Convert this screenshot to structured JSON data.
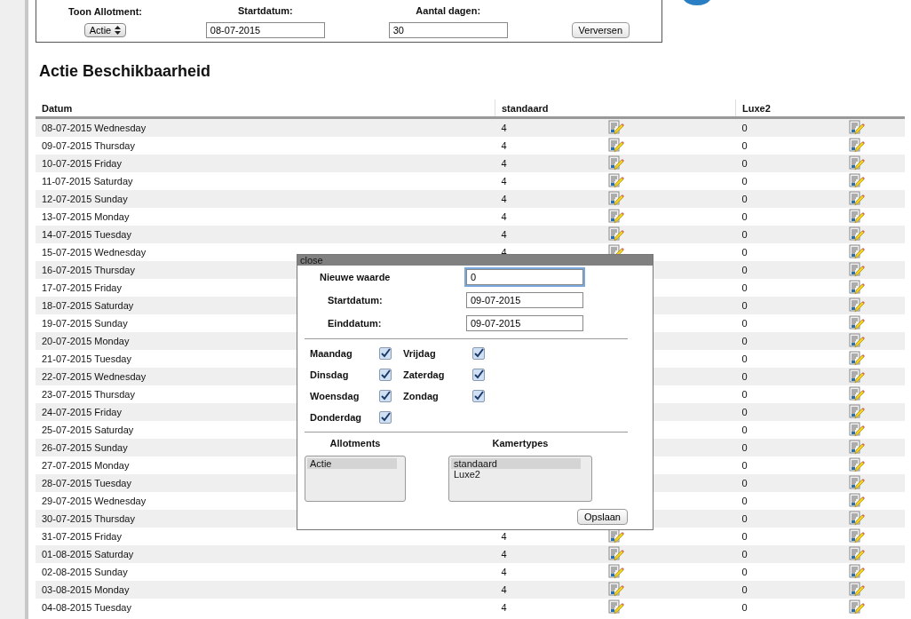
{
  "filter": {
    "allotment_label": "Toon Allotment:",
    "allotment_value": "Actie",
    "start_label": "Startdatum:",
    "start_value": "08-07-2015",
    "days_label": "Aantal dagen:",
    "days_value": "30",
    "refresh_button": "Verversen"
  },
  "heading": "Actie Beschikbaarheid",
  "table": {
    "columns": [
      "Datum",
      "standaard",
      "Luxe2"
    ],
    "rows": [
      {
        "date": "08-07-2015 Wednesday",
        "standaard": "4",
        "luxe2": "0"
      },
      {
        "date": "09-07-2015 Thursday",
        "standaard": "4",
        "luxe2": "0"
      },
      {
        "date": "10-07-2015 Friday",
        "standaard": "4",
        "luxe2": "0"
      },
      {
        "date": "11-07-2015 Saturday",
        "standaard": "4",
        "luxe2": "0"
      },
      {
        "date": "12-07-2015 Sunday",
        "standaard": "4",
        "luxe2": "0"
      },
      {
        "date": "13-07-2015 Monday",
        "standaard": "4",
        "luxe2": "0"
      },
      {
        "date": "14-07-2015 Tuesday",
        "standaard": "4",
        "luxe2": "0"
      },
      {
        "date": "15-07-2015 Wednesday",
        "standaard": "4",
        "luxe2": "0"
      },
      {
        "date": "16-07-2015 Thursday",
        "luxe2": "0"
      },
      {
        "date": "17-07-2015 Friday",
        "luxe2": "0"
      },
      {
        "date": "18-07-2015 Saturday",
        "luxe2": "0"
      },
      {
        "date": "19-07-2015 Sunday",
        "luxe2": "0"
      },
      {
        "date": "20-07-2015 Monday",
        "luxe2": "0"
      },
      {
        "date": "21-07-2015 Tuesday",
        "luxe2": "0"
      },
      {
        "date": "22-07-2015 Wednesday",
        "luxe2": "0"
      },
      {
        "date": "23-07-2015 Thursday",
        "luxe2": "0"
      },
      {
        "date": "24-07-2015 Friday",
        "luxe2": "0"
      },
      {
        "date": "25-07-2015 Saturday",
        "luxe2": "0"
      },
      {
        "date": "26-07-2015 Sunday",
        "luxe2": "0"
      },
      {
        "date": "27-07-2015 Monday",
        "luxe2": "0"
      },
      {
        "date": "28-07-2015 Tuesday",
        "luxe2": "0"
      },
      {
        "date": "29-07-2015 Wednesday",
        "luxe2": "0"
      },
      {
        "date": "30-07-2015 Thursday",
        "luxe2": "0"
      },
      {
        "date": "31-07-2015 Friday",
        "standaard": "4",
        "luxe2": "0"
      },
      {
        "date": "01-08-2015 Saturday",
        "standaard": "4",
        "luxe2": "0"
      },
      {
        "date": "02-08-2015 Sunday",
        "standaard": "4",
        "luxe2": "0"
      },
      {
        "date": "03-08-2015 Monday",
        "standaard": "4",
        "luxe2": "0"
      },
      {
        "date": "04-08-2015 Tuesday",
        "standaard": "4",
        "luxe2": "0"
      }
    ]
  },
  "dialog": {
    "close": "close",
    "value_label": "Nieuwe waarde",
    "value": "0",
    "start_label": "Startdatum:",
    "start_value": "09-07-2015",
    "end_label": "Einddatum:",
    "end_value": "09-07-2015",
    "days": [
      {
        "label": "Maandag",
        "checked": true
      },
      {
        "label": "Vrijdag",
        "checked": true
      },
      {
        "label": "Dinsdag",
        "checked": true
      },
      {
        "label": "Zaterdag",
        "checked": true
      },
      {
        "label": "Woensdag",
        "checked": true
      },
      {
        "label": "Zondag",
        "checked": true
      },
      {
        "label": "Donderdag",
        "checked": true
      }
    ],
    "allotments_label": "Allotments",
    "allotments": [
      {
        "label": "Actie",
        "selected": true
      }
    ],
    "roomtypes_label": "Kamertypes",
    "roomtypes": [
      {
        "label": "standaard",
        "selected": true
      },
      {
        "label": "Luxe2",
        "selected": false
      }
    ],
    "save_button": "Opslaan"
  }
}
